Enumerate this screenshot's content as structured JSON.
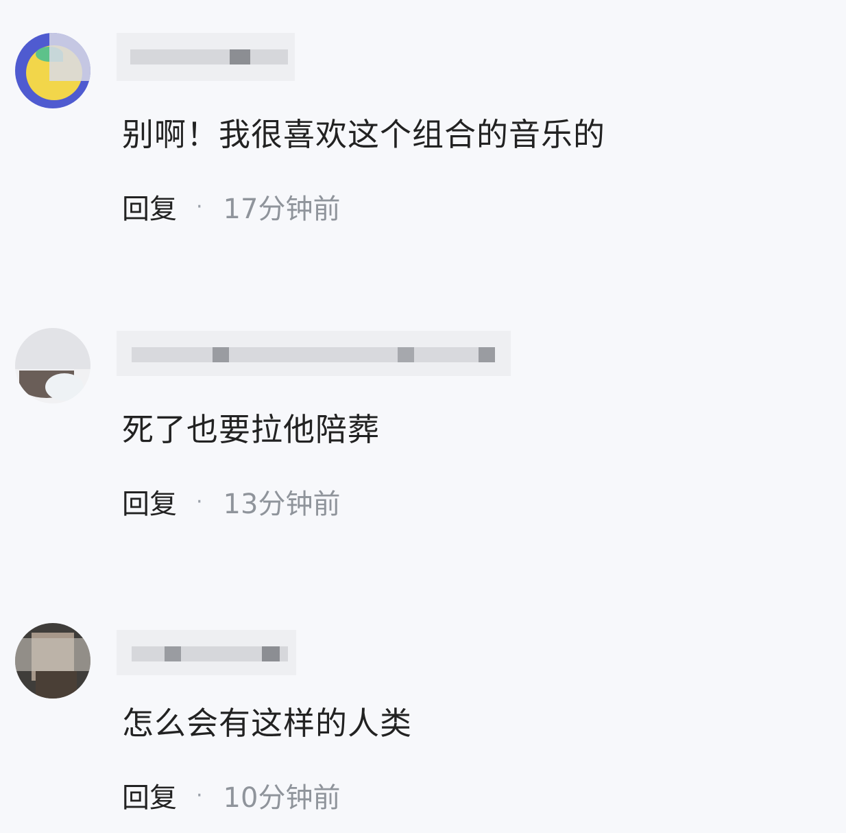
{
  "comments": [
    {
      "text": "别啊！我很喜欢这个组合的音乐的",
      "reply_label": "回复",
      "separator": "·",
      "time": "17分钟前"
    },
    {
      "text": "死了也要拉他陪葬",
      "reply_label": "回复",
      "separator": "·",
      "time": "13分钟前"
    },
    {
      "text": "怎么会有这样的人类",
      "reply_label": "回复",
      "separator": "·",
      "time": "10分钟前"
    }
  ],
  "colors": {
    "background": "#f7f8fb",
    "text": "#222222",
    "time": "#8f949b",
    "pixelate_light": "#e4e5e8",
    "pixelate_dark": "#8c8e93"
  }
}
